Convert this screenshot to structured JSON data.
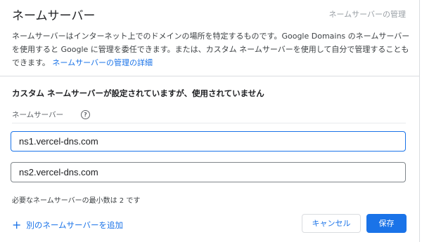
{
  "header": {
    "title": "ネームサーバー",
    "manage_link": "ネームサーバーの管理"
  },
  "description": {
    "text": "ネームサーバーはインターネット上でのドメインの場所を特定するものです。Google Domains のネームサーバーを使用すると Google に管理を委任できます。または、カスタム ネームサーバーを使用して自分で管理することもできます。",
    "link": "ネームサーバーの管理の詳細"
  },
  "warning": "カスタム ネームサーバーが設定されていますが、使用されていません",
  "nameserver_section": {
    "label": "ネームサーバー",
    "help_icon": "help-circle-icon",
    "fields": [
      {
        "value": "ns1.vercel-dns.com",
        "focused": true
      },
      {
        "value": "ns2.vercel-dns.com",
        "focused": false
      }
    ],
    "min_note": "必要なネームサーバーの最小数は 2 です"
  },
  "actions": {
    "add_label": "別のネームサーバーを追加",
    "add_icon": "plus-icon",
    "cancel_label": "キャンセル",
    "save_label": "保存"
  },
  "colors": {
    "accent": "#1a73e8",
    "border": "#dadce0",
    "muted_text": "#9aa0a6"
  }
}
